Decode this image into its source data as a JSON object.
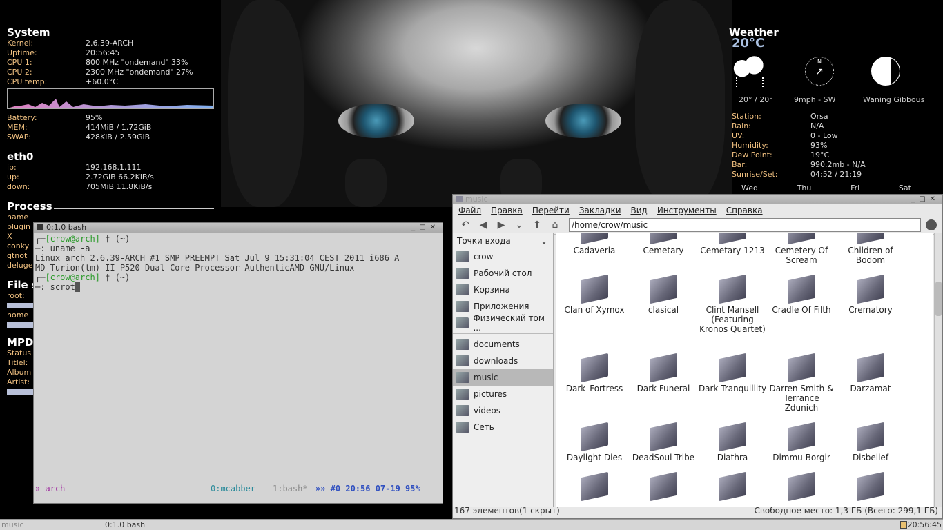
{
  "system": {
    "title": "System",
    "rows": [
      {
        "k": "Kernel:",
        "v": "2.6.39-ARCH"
      },
      {
        "k": "Uptime:",
        "v": "20:56:45"
      },
      {
        "k": "CPU 1:",
        "v": "800 MHz     \"ondemand\"    33%"
      },
      {
        "k": "CPU 2:",
        "v": "2300 MHz    \"ondemand\"    27%"
      },
      {
        "k": "CPU temp:",
        "v": "+60.0°C"
      }
    ],
    "rows2": [
      {
        "k": "Battery:",
        "v": " 95%"
      },
      {
        "k": "MEM:",
        "v": "414MiB   /  1.72GiB"
      },
      {
        "k": "SWAP:",
        "v": "428KiB   /  2.59GiB"
      }
    ]
  },
  "net": {
    "title": "eth0",
    "rows": [
      {
        "k": " ip:",
        "v": "192.168.1.111"
      },
      {
        "k": " up:",
        "v": "2.72GiB     66.2KiB/s"
      },
      {
        "k": " down:",
        "v": "705MiB      11.8KiB/s"
      }
    ]
  },
  "process": {
    "title": "Process",
    "items": [
      "name",
      "plugin",
      "X",
      "conky",
      "qtnot",
      "deluge"
    ]
  },
  "fs": {
    "title": "File s",
    "root": "root:",
    "home": "home"
  },
  "mpd": {
    "title": "MPD",
    "items": [
      "Status",
      "Titlel:",
      "Album",
      "Artist:"
    ]
  },
  "weather": {
    "title": "Weather",
    "temp": "20°C",
    "range": "20° / 20°",
    "wind": "9mph - SW",
    "moon": "Waning Gibbous",
    "rows": [
      {
        "k": "Station:",
        "v": "Orsa"
      },
      {
        "k": "Rain:",
        "v": "N/A"
      },
      {
        "k": "UV:",
        "v": "0 - Low"
      },
      {
        "k": "Humidity:",
        "v": "93%"
      },
      {
        "k": "Dew Point:",
        "v": "19°C"
      },
      {
        "k": "Bar:",
        "v": "990.2mb - N/A"
      },
      {
        "k": "Sunrise/Set:",
        "v": "04:52 / 21:19"
      }
    ],
    "days": [
      "Wed",
      "Thu",
      "Fri",
      "Sat"
    ]
  },
  "terminal": {
    "title": "0:1.0 bash",
    "prompt1": "[crow@arch]",
    "dir1": " † (~)",
    "cmd1": "─: uname -a",
    "out1": "Linux arch 2.6.39-ARCH #1 SMP PREEMPT Sat Jul 9 15:31:04 CEST 2011 i686 A",
    "out2": "MD Turion(tm) II P520 Dual-Core Processor AuthenticAMD GNU/Linux",
    "prompt2": "[crow@arch]",
    "dir2": " † (~)",
    "cmd2": "─: scrot",
    "status_left": "» arch",
    "status_win1": "0:mcabber-",
    "status_win2": "1:bash*",
    "status_right": "»» #0 20:56 07-19 95%"
  },
  "fm": {
    "title": "music",
    "menu": [
      "Файл",
      "Правка",
      "Перейти",
      "Закладки",
      "Вид",
      "Инструменты",
      "Справка"
    ],
    "address": "/home/crow/music",
    "places_header": "Точки входа",
    "places": [
      "crow",
      "Рабочий стол",
      "Корзина",
      "Приложения",
      "Физический том ..."
    ],
    "bookmarks": [
      "documents",
      "downloads",
      "music",
      "pictures",
      "videos",
      "Сеть"
    ],
    "folders": [
      "Cadaveria",
      "Cemetary",
      "Cemetary 1213",
      "Cemetery Of Scream",
      "Children of Bodom",
      "Clan of Xymox",
      "clasical",
      "Clint Mansell (Featuring Kronos Quartet)",
      "Cradle Of Filth",
      "Crematory",
      "Dark_Fortress",
      "Dark Funeral",
      "Dark Tranquillity",
      "Darren Smith & Terrance Zdunich",
      "Darzamat",
      "Daylight Dies",
      "DeadSoul Tribe",
      "Diathra",
      "Dimmu Borgir",
      "Disbelief",
      "",
      "",
      "",
      "",
      ""
    ],
    "status_left": "167 элементов(1 скрыт)",
    "status_right": "Свободное место: 1,3 ГБ (Всего: 299,1 ГБ)"
  },
  "panel": {
    "task1": "music",
    "task2": "0:1.0 bash",
    "clock": "20:56:45"
  }
}
